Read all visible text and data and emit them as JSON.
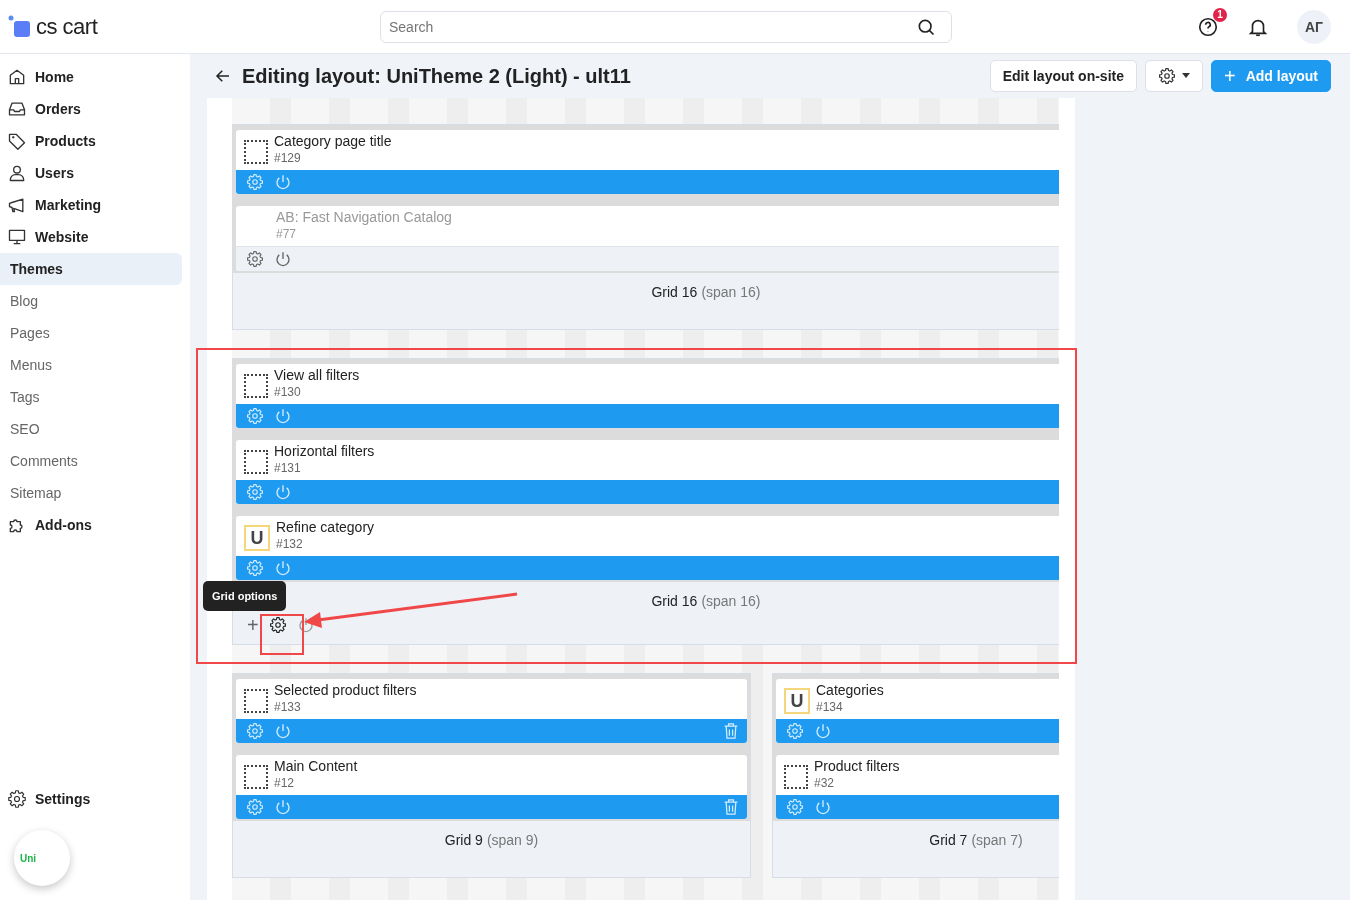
{
  "header": {
    "logo": "cs cart",
    "search": {
      "placeholder": "Search"
    },
    "help_badge": "1",
    "avatar": "АГ"
  },
  "sidebar": {
    "items": [
      {
        "label": "Home",
        "kind": "section",
        "selected": false
      },
      {
        "label": "Orders",
        "kind": "section",
        "selected": false
      },
      {
        "label": "Products",
        "kind": "section",
        "selected": false
      },
      {
        "label": "Users",
        "kind": "section",
        "selected": false
      },
      {
        "label": "Marketing",
        "kind": "section",
        "selected": false
      },
      {
        "label": "Website",
        "kind": "section",
        "selected": false
      },
      {
        "label": "Themes",
        "kind": "page",
        "selected": true
      },
      {
        "label": "Blog",
        "kind": "page",
        "selected": false
      },
      {
        "label": "Pages",
        "kind": "page",
        "selected": false
      },
      {
        "label": "Menus",
        "kind": "page",
        "selected": false
      },
      {
        "label": "Tags",
        "kind": "page",
        "selected": false
      },
      {
        "label": "SEO",
        "kind": "page",
        "selected": false
      },
      {
        "label": "Comments",
        "kind": "page",
        "selected": false
      },
      {
        "label": "Sitemap",
        "kind": "page",
        "selected": false
      },
      {
        "label": "Add-ons",
        "kind": "section",
        "selected": false
      }
    ],
    "settings": "Settings",
    "badge": "Uni"
  },
  "page": {
    "title": "Editing layout: UniTheme 2 (Light) - ult11",
    "buttons": {
      "edit": "Edit layout on-site",
      "add": "Add layout",
      "add_icon": "+"
    }
  },
  "layout": [
    {
      "grids": [
        {
          "name": "Grid 16",
          "span": "(span 16)",
          "controls_shown": false,
          "blocks": [
            {
              "title": "Category page title",
              "id": "#129",
              "icon": {
                "kind": "dotted"
              },
              "active": true
            },
            {
              "title": "AB: Fast Navigation Catalog",
              "id": "#77",
              "icon": {
                "kind": "none"
              },
              "active": false
            }
          ]
        }
      ]
    },
    {
      "grids": [
        {
          "name": "Grid 16",
          "span": "(span 16)",
          "controls_shown": true,
          "tooltip": "Grid options",
          "add_icon": "+",
          "blocks": [
            {
              "title": "View all filters",
              "id": "#130",
              "icon": {
                "kind": "dotted"
              },
              "active": true
            },
            {
              "title": "Horizontal filters",
              "id": "#131",
              "icon": {
                "kind": "dotted"
              },
              "active": true
            },
            {
              "title": "Refine category",
              "id": "#132",
              "icon": {
                "kind": "letter",
                "text": "U"
              },
              "active": true
            }
          ]
        }
      ]
    },
    {
      "grids": [
        {
          "name": "Grid 9",
          "span": "(span 9)",
          "controls_shown": false,
          "blocks": [
            {
              "title": "Selected product filters",
              "id": "#133",
              "icon": {
                "kind": "dotted"
              },
              "active": true,
              "deletable": true
            },
            {
              "title": "Main Content",
              "id": "#12",
              "icon": {
                "kind": "dotted"
              },
              "active": true,
              "deletable": true
            }
          ]
        },
        {
          "name": "Grid 7",
          "span": "(span 7)",
          "controls_shown": false,
          "blocks": [
            {
              "title": "Categories",
              "id": "#134",
              "icon": {
                "kind": "letter",
                "text": "U"
              },
              "active": true
            },
            {
              "title": "Product filters",
              "id": "#32",
              "icon": {
                "kind": "dotted"
              },
              "active": true
            }
          ]
        }
      ]
    }
  ]
}
